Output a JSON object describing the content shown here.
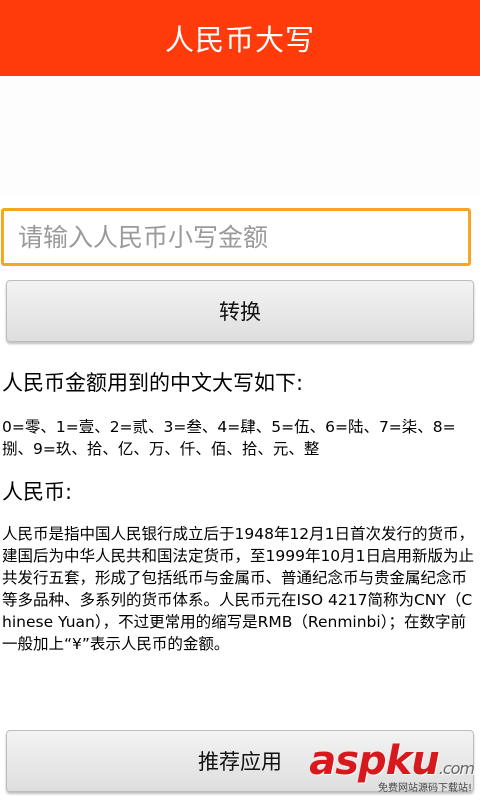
{
  "app": {
    "title": "人民币大写"
  },
  "input": {
    "placeholder": "请输入人民币小写金额",
    "value": ""
  },
  "buttons": {
    "convert_label": "转换",
    "recommend_label": "推荐应用"
  },
  "content": {
    "heading_chars": "人民币金额用到的中文大写如下:",
    "chars_text": "0=零、1=壹、2=贰、3=叁、4=肆、5=伍、6=陆、7=柒、8=捌、9=玖、拾、亿、万、仟、佰、拾、元、整",
    "heading_rmb": "人民币:",
    "rmb_text": "人民币是指中国人民银行成立后于1948年12月1日首次发行的货币，建国后为中华人民共和国法定货币，至1999年10月1日启用新版为止共发行五套，形成了包括纸币与金属币、普通纪念币与贵金属纪念币等多品种、多系列的货币体系。人民币元在ISO 4217简称为CNY（Chinese Yuan），不过更常用的缩写是RMB（Renminbi）；在数字前一般加上“¥”表示人民币的金额。"
  },
  "watermark": {
    "logo": "aspku",
    "logo_suffix": ".com",
    "subtitle": "免费网站源码下载站!"
  },
  "colors": {
    "titlebar": "#ff3b0b",
    "input_border": "#f5a623"
  }
}
